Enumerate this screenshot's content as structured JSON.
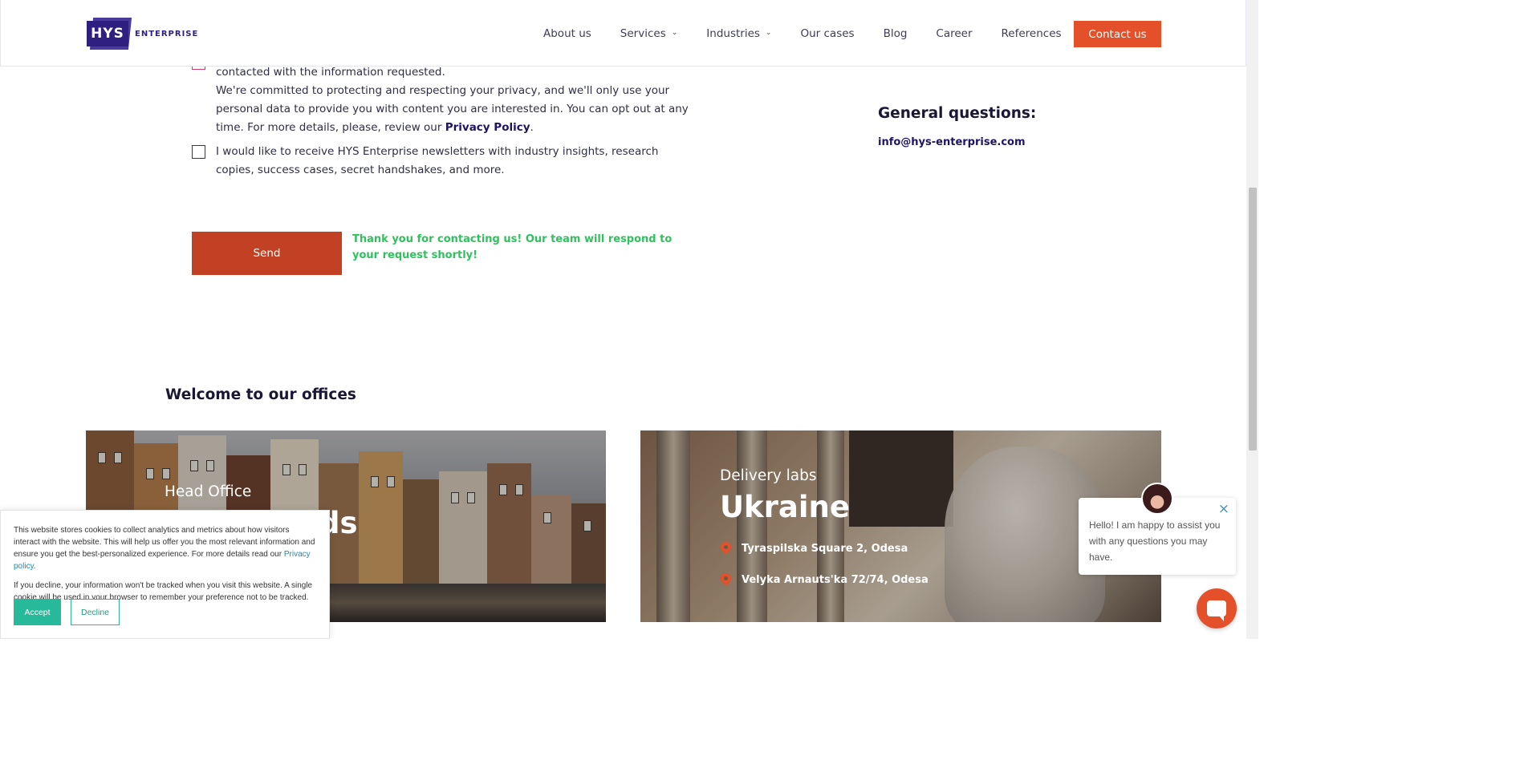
{
  "header": {
    "logo_mark": "HYS",
    "logo_word": "ENTERPRISE",
    "nav": [
      {
        "label": "About us"
      },
      {
        "label": "Services",
        "has_dropdown": true
      },
      {
        "label": "Industries",
        "has_dropdown": true
      },
      {
        "label": "Our cases"
      },
      {
        "label": "Blog"
      },
      {
        "label": "Career"
      },
      {
        "label": "References"
      }
    ],
    "contact_label": "Contact us"
  },
  "form": {
    "consent_text_partial": "contacted with the information requested.",
    "privacy_text": "We're committed to protecting and respecting your privacy, and we'll only use your personal data to provide you with content you are interested in. You can opt out at any time. For more details, please, review our",
    "privacy_link": "Privacy Policy",
    "privacy_end": ".",
    "newsletter_text": "I would like to receive HYS Enterprise newsletters with industry insights, research copies, success cases, secret handshakes, and more.",
    "send_label": "Send",
    "thanks_message": "Thank you for contacting us! Our team will respond to your request shortly!"
  },
  "general_questions": {
    "title": "General questions:",
    "email": "info@hys-enterprise.com"
  },
  "offices": {
    "title": "Welcome to our offices",
    "head_office": {
      "sub": "Head Office",
      "country_partial": "ds"
    },
    "delivery": {
      "sub": "Delivery labs",
      "country": "Ukraine",
      "addresses": [
        "Tyraspilska Square 2, Odesa",
        "Velyka Arnauts'ka 72/74, Odesa"
      ]
    }
  },
  "cookie": {
    "text1": "This website stores cookies to collect analytics and metrics about how visitors interact with the website. This will help us offer you the most relevant information and ensure you get the best-personalized experience. For more details read our",
    "link": "Privacy policy.",
    "text2": "If you decline, your information won't be tracked when you visit this website. A single cookie will be used in your browser to remember your preference not to be tracked.",
    "accept_label": "Accept",
    "decline_label": "Decline"
  },
  "chat": {
    "message": "Hello! I am happy to assist you with any questions you may have.",
    "close_glyph": "×"
  },
  "colors": {
    "brand": "#2e1f80",
    "accent": "#e4502a",
    "send": "#c24124",
    "success": "#2fc25c",
    "cookie_accent": "#26b99a"
  }
}
